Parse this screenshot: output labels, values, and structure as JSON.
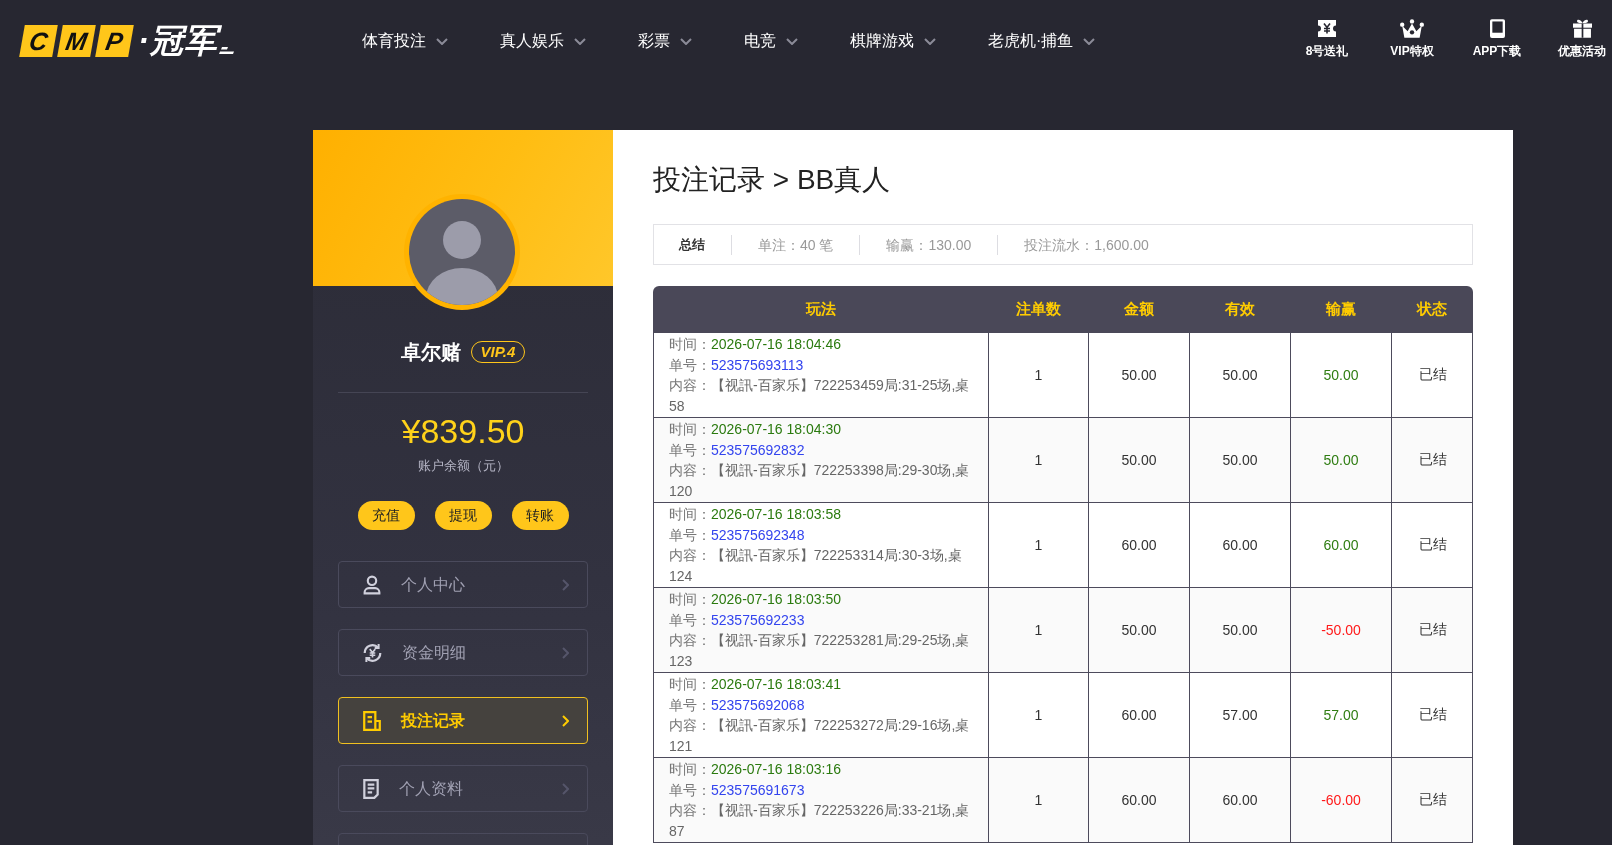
{
  "header": {
    "logo": {
      "tiles": [
        "C",
        "M",
        "P"
      ],
      "name": "·冠军"
    },
    "nav": [
      {
        "label": "体育投注"
      },
      {
        "label": "真人娱乐"
      },
      {
        "label": "彩票"
      },
      {
        "label": "电竞"
      },
      {
        "label": "棋牌游戏"
      },
      {
        "label": "老虎机·捕鱼"
      }
    ],
    "quick_links": [
      {
        "label": "8号送礼"
      },
      {
        "label": "VIP特权"
      },
      {
        "label": "APP下载"
      },
      {
        "label": "优惠活动"
      }
    ]
  },
  "sidebar": {
    "username": "卓尔赌",
    "vip_badge": "VIP.4",
    "balance": "¥839.50",
    "balance_label": "账户余额（元）",
    "actions": [
      {
        "label": "充值"
      },
      {
        "label": "提现"
      },
      {
        "label": "转账"
      }
    ],
    "menu": [
      {
        "label": "个人中心",
        "selected": false
      },
      {
        "label": "资金明细",
        "selected": false
      },
      {
        "label": "投注记录",
        "selected": true
      },
      {
        "label": "个人资料",
        "selected": false
      }
    ]
  },
  "main": {
    "title": "投注记录 > BB真人",
    "summary": [
      {
        "kind": "heading",
        "text": "总结"
      },
      {
        "kind": "stat",
        "text": "单注：40 笔"
      },
      {
        "kind": "stat",
        "text": "输赢：130.00"
      },
      {
        "kind": "stat",
        "text": "投注流水：1,600.00"
      }
    ],
    "table": {
      "columns": [
        "玩法",
        "注单数",
        "金额",
        "有效",
        "输赢",
        "状态"
      ],
      "rows": [
        {
          "time_label": "时间：",
          "time": "2026-07-16 18:04:46",
          "order_label": "单号：",
          "order_no": "523575693113",
          "content_label": "内容：",
          "content": "【视訊-百家乐】722253459局:31-25场,桌58",
          "count": "1",
          "amount": "50.00",
          "valid": "50.00",
          "win_loss": "50.00",
          "loss": false,
          "status": "已结"
        },
        {
          "time_label": "时间：",
          "time": "2026-07-16 18:04:30",
          "order_label": "单号：",
          "order_no": "523575692832",
          "content_label": "内容：",
          "content": "【视訊-百家乐】722253398局:29-30场,桌120",
          "count": "1",
          "amount": "50.00",
          "valid": "50.00",
          "win_loss": "50.00",
          "loss": false,
          "status": "已结"
        },
        {
          "time_label": "时间：",
          "time": "2026-07-16 18:03:58",
          "order_label": "单号：",
          "order_no": "523575692348",
          "content_label": "内容：",
          "content": "【视訊-百家乐】722253314局:30-3场,桌124",
          "count": "1",
          "amount": "60.00",
          "valid": "60.00",
          "win_loss": "60.00",
          "loss": false,
          "status": "已结"
        },
        {
          "time_label": "时间：",
          "time": "2026-07-16 18:03:50",
          "order_label": "单号：",
          "order_no": "523575692233",
          "content_label": "内容：",
          "content": "【视訊-百家乐】722253281局:29-25场,桌123",
          "count": "1",
          "amount": "50.00",
          "valid": "50.00",
          "win_loss": "-50.00",
          "loss": true,
          "status": "已结"
        },
        {
          "time_label": "时间：",
          "time": "2026-07-16 18:03:41",
          "order_label": "单号：",
          "order_no": "523575692068",
          "content_label": "内容：",
          "content": "【视訊-百家乐】722253272局:29-16场,桌121",
          "count": "1",
          "amount": "60.00",
          "valid": "57.00",
          "win_loss": "57.00",
          "loss": false,
          "status": "已结"
        },
        {
          "time_label": "时间：",
          "time": "2026-07-16 18:03:16",
          "order_label": "单号：",
          "order_no": "523575691673",
          "content_label": "内容：",
          "content": "【视訊-百家乐】722253226局:33-21场,桌87",
          "count": "1",
          "amount": "60.00",
          "valid": "60.00",
          "win_loss": "-60.00",
          "loss": true,
          "status": "已结"
        }
      ]
    }
  }
}
